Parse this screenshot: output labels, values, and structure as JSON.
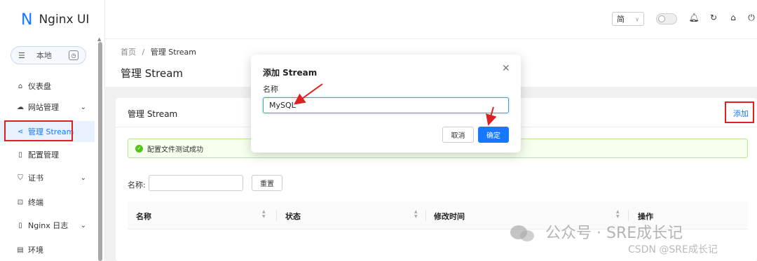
{
  "app": {
    "title": "Nginx UI",
    "logo_letter": "N"
  },
  "env": {
    "label": "本地",
    "left_icon": "list-icon",
    "right_icon": "clock-icon"
  },
  "sidebar": {
    "items": [
      {
        "label": "仪表盘",
        "icon": "home-icon"
      },
      {
        "label": "网站管理",
        "icon": "cloud-icon",
        "expand": "⌄"
      },
      {
        "label": "管理 Stream",
        "icon": "share-icon",
        "active": true
      },
      {
        "label": "配置管理",
        "icon": "file-icon"
      },
      {
        "label": "证书",
        "icon": "shield-icon",
        "expand": "⌄"
      },
      {
        "label": "终端",
        "icon": "terminal-icon"
      },
      {
        "label": "Nginx 日志",
        "icon": "doc-icon",
        "expand": "⌄"
      },
      {
        "label": "环境",
        "icon": "db-icon"
      }
    ]
  },
  "topbar": {
    "lang": "简"
  },
  "breadcrumb": {
    "home": "首页",
    "sep": "/",
    "current": "管理 Stream"
  },
  "page": {
    "title": "管理 Stream"
  },
  "card": {
    "title": "管理 Stream",
    "add": "添加",
    "alert": "配置文件测试成功",
    "filter_label": "名称:",
    "reset": "重置",
    "columns": [
      "名称",
      "状态",
      "修改时间",
      "操作"
    ]
  },
  "modal": {
    "title": "添加 Stream",
    "field_label": "名称",
    "field_value": "MySQL",
    "cancel": "取消",
    "ok": "确定"
  },
  "watermark": {
    "main": "公众号 · SRE成长记",
    "sub": "CSDN @SRE成长记"
  },
  "colors": {
    "primary": "#1677ff",
    "annotation": "#e02020",
    "success": "#52c41a"
  }
}
